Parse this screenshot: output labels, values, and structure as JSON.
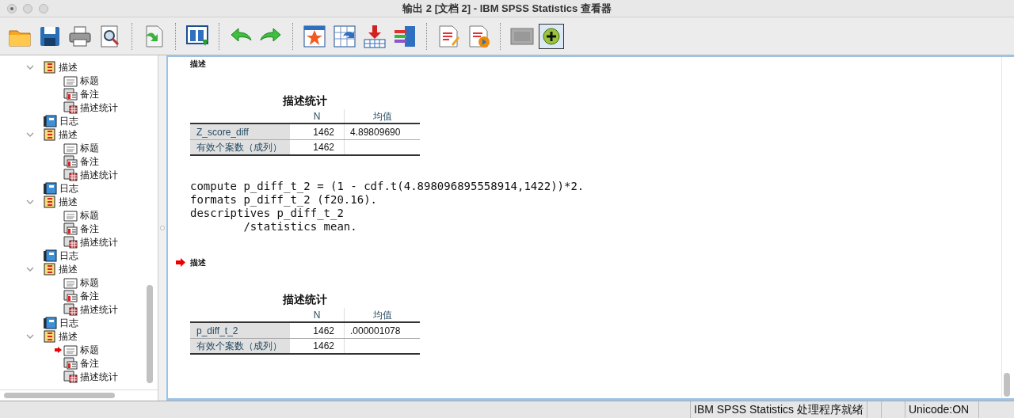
{
  "window": {
    "title": "输出 2 [文档 2] - IBM SPSS Statistics 查看器"
  },
  "outline": {
    "items": [
      {
        "kind": "procedure",
        "label": "描述",
        "expanded": true,
        "children": [
          {
            "kind": "title",
            "label": "标题",
            "current": false
          },
          {
            "kind": "notes",
            "label": "备注",
            "current": false
          },
          {
            "kind": "table",
            "label": "描述统计",
            "current": false
          }
        ]
      },
      {
        "kind": "log",
        "label": "日志"
      },
      {
        "kind": "procedure",
        "label": "描述",
        "expanded": true,
        "children": [
          {
            "kind": "title",
            "label": "标题",
            "current": false
          },
          {
            "kind": "notes",
            "label": "备注",
            "current": false
          },
          {
            "kind": "table",
            "label": "描述统计",
            "current": false
          }
        ]
      },
      {
        "kind": "log",
        "label": "日志"
      },
      {
        "kind": "procedure",
        "label": "描述",
        "expanded": true,
        "children": [
          {
            "kind": "title",
            "label": "标题",
            "current": false
          },
          {
            "kind": "notes",
            "label": "备注",
            "current": false
          },
          {
            "kind": "table",
            "label": "描述统计",
            "current": false
          }
        ]
      },
      {
        "kind": "log",
        "label": "日志"
      },
      {
        "kind": "procedure",
        "label": "描述",
        "expanded": true,
        "children": [
          {
            "kind": "title",
            "label": "标题",
            "current": false
          },
          {
            "kind": "notes",
            "label": "备注",
            "current": false
          },
          {
            "kind": "table",
            "label": "描述统计",
            "current": false
          }
        ]
      },
      {
        "kind": "log",
        "label": "日志"
      },
      {
        "kind": "procedure",
        "label": "描述",
        "expanded": true,
        "children": [
          {
            "kind": "title",
            "label": "标题",
            "current": true
          },
          {
            "kind": "notes",
            "label": "备注",
            "current": false
          },
          {
            "kind": "table",
            "label": "描述统计",
            "current": false
          }
        ]
      }
    ]
  },
  "output": {
    "blocks": [
      {
        "kind": "heading",
        "text": "描述",
        "current": false
      },
      {
        "kind": "table",
        "title": "描述统计",
        "columns": [
          "N",
          "均值"
        ],
        "rows": [
          {
            "label": "Z_score_diff",
            "cells": [
              "1462",
              "4.89809690"
            ]
          },
          {
            "label": "有效个案数（成列）",
            "cells": [
              "1462"
            ]
          }
        ]
      },
      {
        "kind": "syntax",
        "lines": [
          "compute p_diff_t_2 = (1 - cdf.t(4.898096895558914,1422))*2.",
          "formats p_diff_t_2 (f20.16).",
          "descriptives p_diff_t_2",
          "        /statistics mean."
        ]
      },
      {
        "kind": "heading",
        "text": "描述",
        "current": true
      },
      {
        "kind": "table",
        "title": "描述统计",
        "columns": [
          "N",
          "均值"
        ],
        "rows": [
          {
            "label": "p_diff_t_2",
            "cells": [
              "1462",
              ".000001078"
            ]
          },
          {
            "label": "有效个案数（成列）",
            "cells": [
              "1462"
            ]
          }
        ]
      }
    ]
  },
  "status_bar": {
    "message": "IBM SPSS Statistics 处理程序就绪",
    "encoding": "Unicode:ON"
  }
}
